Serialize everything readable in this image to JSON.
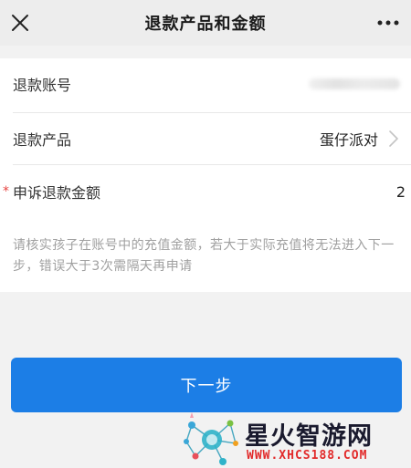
{
  "header": {
    "title": "退款产品和金额",
    "close_icon": "close-icon",
    "more_icon": "more-icon"
  },
  "form": {
    "account": {
      "label": "退款账号",
      "value_masked": true
    },
    "product": {
      "label": "退款产品",
      "value": "蛋仔派对"
    },
    "amount": {
      "required_mark": "*",
      "label": "申诉退款金额",
      "value": "2"
    },
    "hint": "请核实孩子在账号中的充值金额，若大于实际充值将无法进入下一步，错误大于3次需隔天再申请"
  },
  "actions": {
    "next_label": "下一步",
    "accent_color": "#1c7ee6"
  },
  "watermark": {
    "name": "星火智游网",
    "url": "WWW.XHCS188.COM"
  }
}
